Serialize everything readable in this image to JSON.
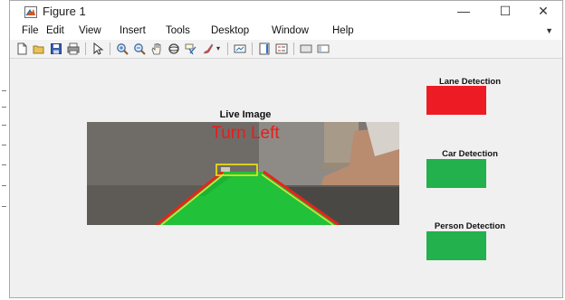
{
  "window": {
    "title": "Figure 1",
    "controls": {
      "minimize": "—",
      "maximize": "☐",
      "close": "✕"
    }
  },
  "menu": [
    "File",
    "Edit",
    "View",
    "Insert",
    "Tools",
    "Desktop",
    "Window",
    "Help"
  ],
  "toolbar": [
    "new-figure",
    "open-file",
    "save-figure",
    "print-figure",
    "edit-plot",
    "zoom-in",
    "zoom-out",
    "pan",
    "rotate-3d",
    "data-cursor",
    "brush",
    "brush-dropdown",
    "link-plot",
    "insert-colorbar",
    "insert-legend",
    "hide-plot-tools",
    "show-plot-tools"
  ],
  "axes": {
    "title": "Live Image",
    "overlay_text": "Turn Left",
    "overlay_color": "#e81c1c"
  },
  "indicators": [
    {
      "label": "Lane Detection",
      "color": "#ed1c24",
      "state": "red"
    },
    {
      "label": "Car Detection",
      "color": "#22b14c",
      "state": "green"
    },
    {
      "label": "Person Detection",
      "color": "#22b14c",
      "state": "green"
    }
  ]
}
